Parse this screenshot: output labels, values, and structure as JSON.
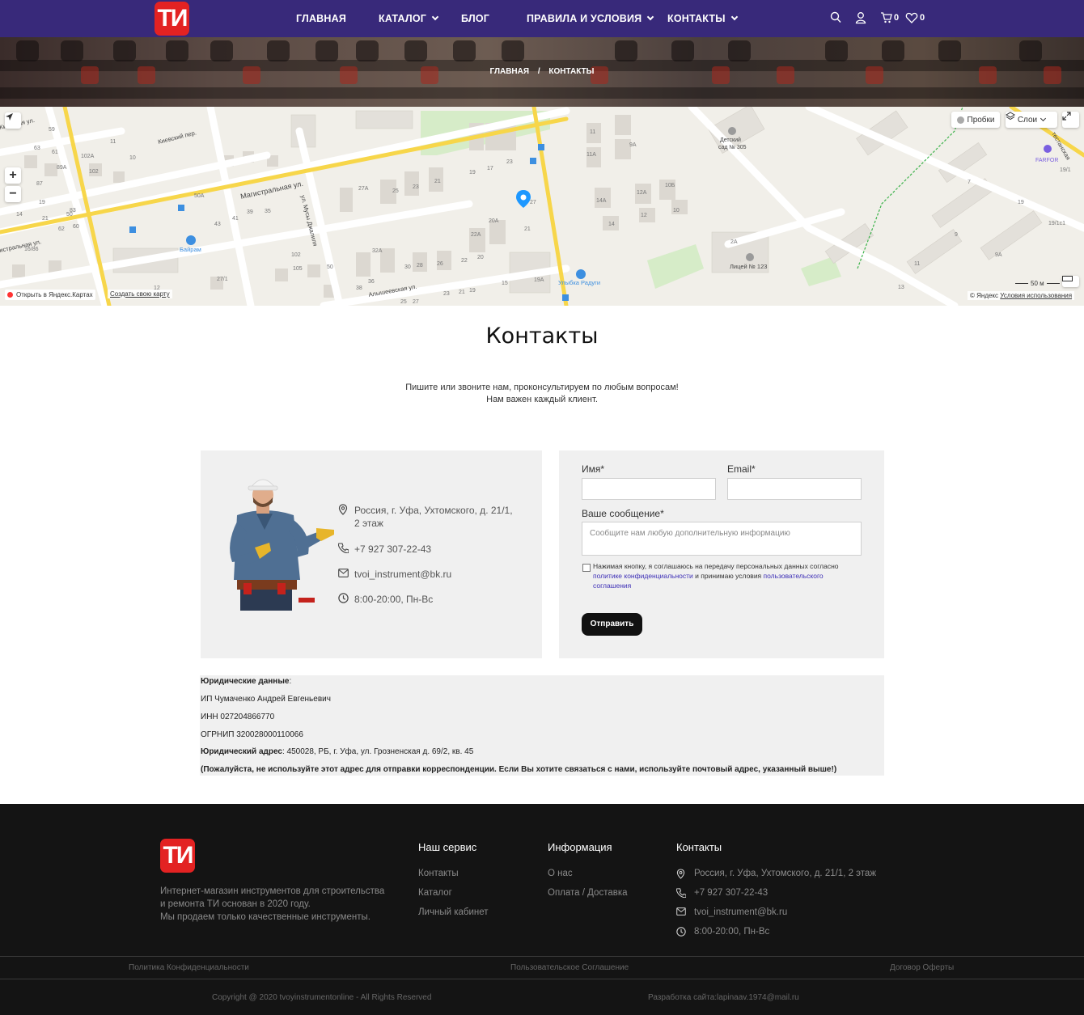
{
  "header": {
    "logo_text": "ТИ",
    "nav": [
      {
        "label": "ГЛАВНАЯ",
        "dropdown": false
      },
      {
        "label": "КАТАЛОГ",
        "dropdown": true
      },
      {
        "label": "БЛОГ",
        "dropdown": false
      },
      {
        "label": "ПРАВИЛА И УСЛОВИЯ",
        "dropdown": true
      },
      {
        "label": "КОНТАКТЫ",
        "dropdown": true
      }
    ],
    "cart_count": "0",
    "wishlist_count": "0",
    "icons": [
      "search-icon",
      "user-icon",
      "cart-icon",
      "heart-icon"
    ]
  },
  "breadcrumb": {
    "home": "ГЛАВНАЯ",
    "separator": "/",
    "current": "КОНТАКТЫ"
  },
  "map": {
    "streets": [
      "Магистральная ул.",
      "Киевский пер.",
      "Киевская ул.",
      "ул. Мусы Джалиля",
      "Алышеевская ул.",
      "истральная ул.",
      "тестанская"
    ],
    "places": [
      "Байрам",
      "Улыбка Радуги",
      "Лицей № 123",
      "Детский сад № 305",
      "FARFOR"
    ],
    "traffic_label": "Пробки",
    "layers_label": "Слои",
    "open_in_label": "Открыть в Яндекс.Картах",
    "create_map_label": "Создать свою карту",
    "scale_label": "50 м",
    "copyright": "© Яндекс",
    "terms_label": "Условия использования"
  },
  "page": {
    "title": "Контакты",
    "subtitle_line1": "Пишите или звоните нам, проконсультируем по любым вопросам!",
    "subtitle_line2": "Нам важен каждый клиент."
  },
  "contacts": {
    "address": "Россия, г. Уфа, Ухтомского, д. 21/1, 2 этаж",
    "phone": "+7 927 307-22-43",
    "email": "tvoi_instrument@bk.ru",
    "hours": "8:00-20:00, Пн-Вс"
  },
  "form": {
    "name_label": "Имя*",
    "email_label": "Email*",
    "message_label": "Ваше сообщение*",
    "message_placeholder": "Сообщите нам любую дополнительную информацию",
    "consent_text_1": "Нажимая кнопку, я соглашаюсь на передачу персональных данных согласно",
    "consent_link_1": "политике конфиденциальности",
    "consent_text_2": " и принимаю условия ",
    "consent_link_2": "пользовательского соглашения",
    "submit_label": "Отправить"
  },
  "legal": {
    "heading": "Юридические данные",
    "heading_colon": ":",
    "owner": "ИП Чумаченко Андрей Евгеньевич",
    "inn": "ИНН 027204866770",
    "ogrnip": "ОГРНИП 320028000110066",
    "address_label": "Юридический адрес",
    "address_value": ": 450028, РБ, г. Уфа, ул. Грозненская д. 69/2, кв. 45",
    "warning": "(Пожалуйста, не используйте этот адрес для отправки корреспонденции. Если Вы хотите связаться с нами, используйте почтовый адрес, указанный выше!)"
  },
  "footer": {
    "logo_text": "ТИ",
    "description_line1": "Интернет-магазин инструментов для строительства",
    "description_line2": "и ремонта ТИ основан в 2020 году.",
    "description_line3": "Мы продаем только качественные инструменты.",
    "service_title": "Наш сервис",
    "service_links": [
      "Контакты",
      "Каталог",
      "Личный кабинет"
    ],
    "info_title": "Информация",
    "info_links": [
      "О нас",
      "Оплата / Доставка"
    ],
    "contacts_title": "Контакты",
    "address": "Россия, г. Уфа, Ухтомского, д. 21/1, 2 этаж",
    "phone": "+7 927 307-22-43",
    "email": "tvoi_instrument@bk.ru",
    "hours": "8:00-20:00, Пн-Вс",
    "policy_link": "Политика Конфиденциальности",
    "agreement_link": "Пользовательское Соглашение",
    "offer_link": "Договор Оферты",
    "copyright": "Copyright @ 2020 tvoyinstrumentonline - All Rights Reserved",
    "developer": "Разработка сайта:lapinaav.1974@mail.ru"
  },
  "colors": {
    "header_bg": "#38297a",
    "logo_red": "#e32222",
    "footer_bg": "#141414",
    "link": "#3d2fb6",
    "button": "#111111"
  }
}
